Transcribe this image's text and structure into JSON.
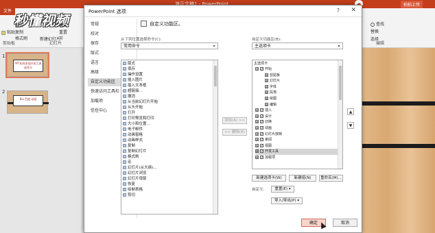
{
  "app": {
    "title": "演示文稿1 - PowerPoint",
    "share_label": "拍拍上传",
    "file_tab": "文件",
    "logo_text": "秒懂视频"
  },
  "ribbon": {
    "paste": "粘贴",
    "cut": "剪切",
    "copy": "复制",
    "format_painter": "格式刷",
    "new_slide": "新建幻灯片",
    "layout": "版式",
    "reset": "重置",
    "section": "节",
    "group_clipboard": "剪贴板",
    "group_slides": "幻灯片",
    "find": "查找",
    "replace": "替换",
    "select": "选择",
    "group_edit": "编辑"
  },
  "slides": [
    {
      "num": "1",
      "text": "PPT如何添加开发工具选项卡"
    },
    {
      "num": "2",
      "text": "Bai 百度 动画"
    }
  ],
  "dialog": {
    "title": "PowerPoint 选项",
    "help": "?",
    "close": "✕",
    "nav": [
      "常规",
      "校对",
      "保存",
      "版式",
      "语言",
      "高级",
      "自定义功能区",
      "快速访问工具栏",
      "加载项",
      "信任中心"
    ],
    "selected_nav": "自定义功能区",
    "heading": "自定义功能区。",
    "left_label": "从下列位置选择命令(C):",
    "left_combo": "常用命令",
    "right_label": "自定义功能区(B):",
    "right_combo": "主选项卡",
    "commands": [
      "版式",
      "保存",
      "操作设置",
      "插入图片",
      "插入文本框",
      "超链接...",
      "撤消",
      "从当前幻灯片开始",
      "从头开始",
      "打开",
      "打印预览和打印",
      "大小和位置...",
      "电子邮件",
      "动画窗格",
      "动画样式",
      "复制",
      "复制幻灯片",
      "格式刷",
      "宏",
      "幻灯片(从大纲)...",
      "幻灯片浏览",
      "幻灯片母版",
      "恢复",
      "绘制表格",
      "剪切"
    ],
    "add_btn": "添加(A) >>",
    "remove_btn": "<< 删除(R)",
    "tree_header": "主选项卡",
    "tree": [
      {
        "label": "开始",
        "level": 0,
        "expander": "⊟",
        "checked": true
      },
      {
        "label": "剪贴板",
        "level": 1,
        "expander": "⊞",
        "checked": false
      },
      {
        "label": "幻灯片",
        "level": 1,
        "expander": "⊞",
        "checked": false
      },
      {
        "label": "字体",
        "level": 1,
        "expander": "⊞",
        "checked": false
      },
      {
        "label": "段落",
        "level": 1,
        "expander": "⊞",
        "checked": false
      },
      {
        "label": "绘图",
        "level": 1,
        "expander": "⊞",
        "checked": false
      },
      {
        "label": "编辑",
        "level": 1,
        "expander": "⊞",
        "checked": false
      },
      {
        "label": "插入",
        "level": 0,
        "expander": "⊞",
        "checked": true
      },
      {
        "label": "设计",
        "level": 0,
        "expander": "⊞",
        "checked": true
      },
      {
        "label": "切换",
        "level": 0,
        "expander": "⊞",
        "checked": true
      },
      {
        "label": "动画",
        "level": 0,
        "expander": "⊞",
        "checked": true
      },
      {
        "label": "幻灯片放映",
        "level": 0,
        "expander": "⊞",
        "checked": true
      },
      {
        "label": "审阅",
        "level": 0,
        "expander": "⊞",
        "checked": true
      },
      {
        "label": "视图",
        "level": 0,
        "expander": "⊞",
        "checked": true
      },
      {
        "label": "开发工具",
        "level": 0,
        "expander": "⊞",
        "checked": true,
        "selected": true
      },
      {
        "label": "加载项",
        "level": 0,
        "expander": "⊞",
        "checked": true
      }
    ],
    "new_tab_btn": "新建选项卡(W)",
    "new_group_btn": "新建组(N)",
    "rename_btn": "重命名(M)...",
    "custom_label": "自定义:",
    "reset_btn": "重置(E) ▾",
    "import_export_btn": "导入/导出(P) ▾",
    "up_arrow": "▲",
    "down_arrow": "▼",
    "ok": "确定",
    "cancel": "取消"
  }
}
